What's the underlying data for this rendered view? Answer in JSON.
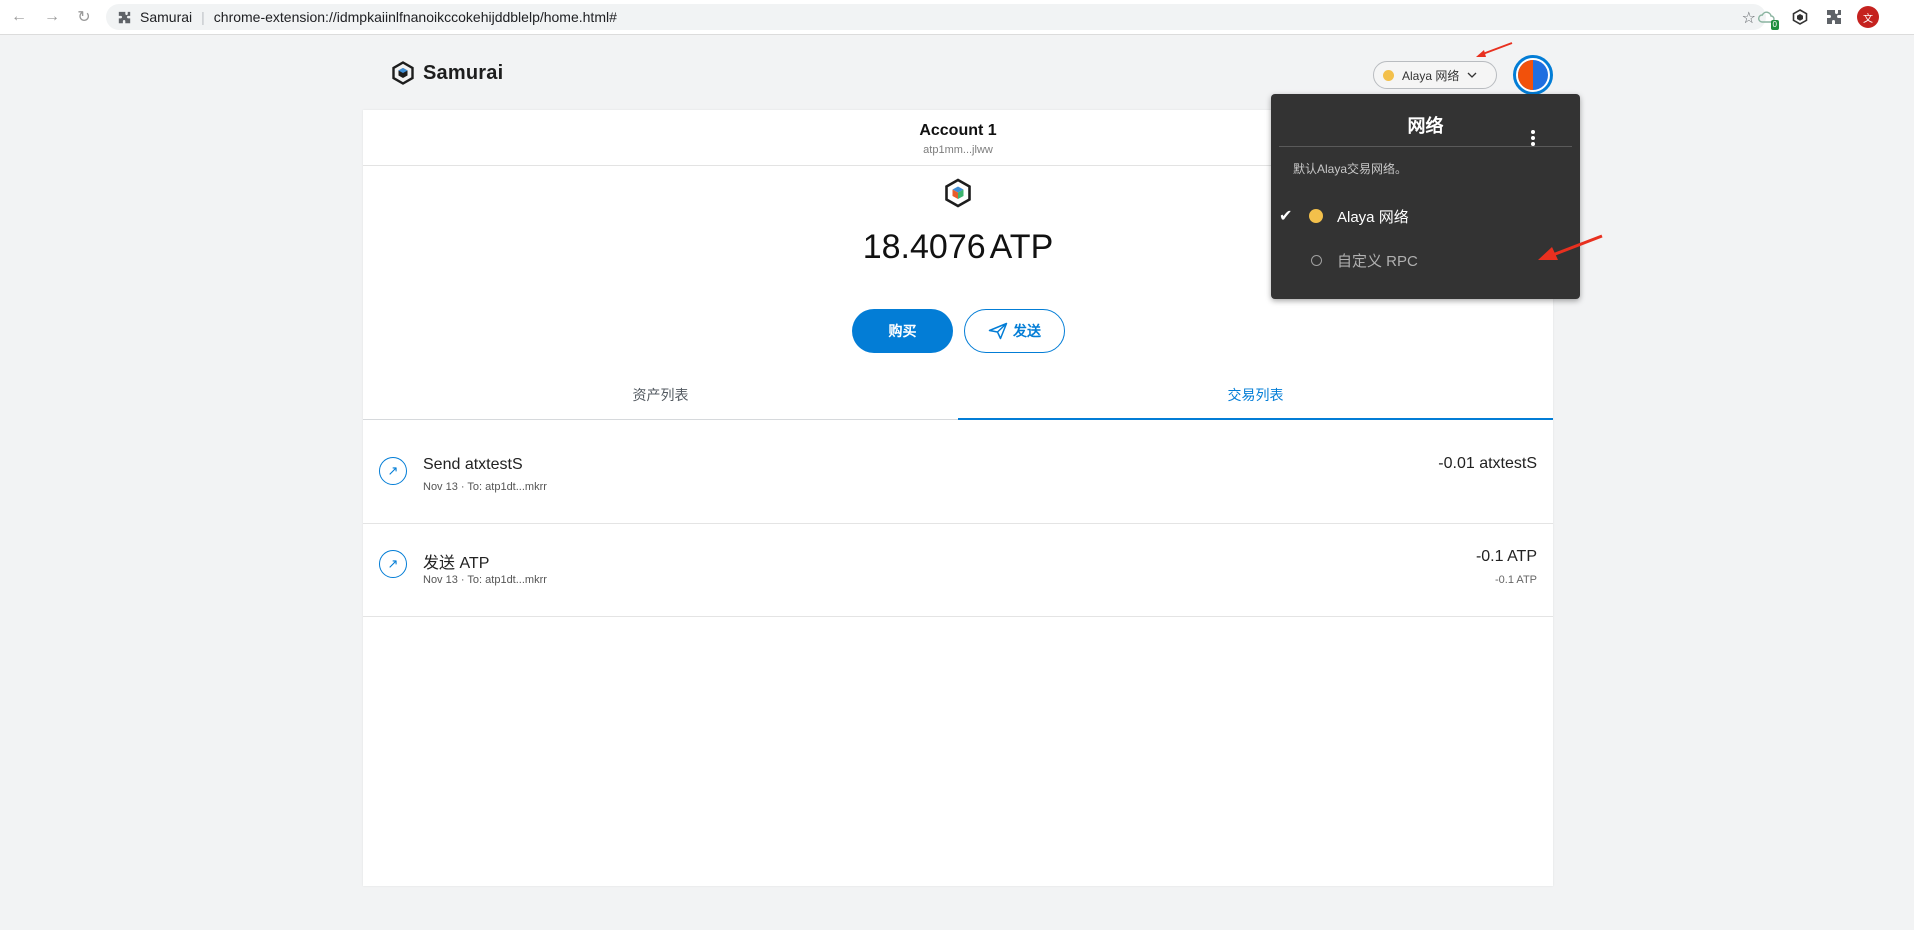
{
  "browser": {
    "site_name": "Samurai",
    "url": "chrome-extension://idmpkaiinlfnanoikccokehijddblelp/home.html#",
    "extension_badge": "0",
    "profile_initial": "文"
  },
  "header": {
    "app_name": "Samurai",
    "network_label": "Alaya 网络",
    "network_dot_color": "#f3c04b"
  },
  "account": {
    "name": "Account 1",
    "address": "atp1mm...jlww"
  },
  "balance": {
    "amount": "18.4076",
    "unit": "ATP"
  },
  "actions": {
    "buy_label": "购买",
    "send_label": "发送"
  },
  "tabs": [
    {
      "label": "资产列表",
      "active": false
    },
    {
      "label": "交易列表",
      "active": true
    }
  ],
  "transactions": [
    {
      "title": "Send atxtestS",
      "subtitle": "Nov 13 · To: atp1dt...mkrr",
      "amount": "-0.01 atxtestS",
      "secondary_amount": ""
    },
    {
      "title": "发送 ATP",
      "subtitle": "Nov 13 · To: atp1dt...mkrr",
      "amount": "-0.1 ATP",
      "secondary_amount": "-0.1 ATP"
    }
  ],
  "network_menu": {
    "title": "网络",
    "description": "默认Alaya交易网络。",
    "options": [
      {
        "label": "Alaya 网络",
        "selected": true,
        "dot_color": "#f3c04b"
      },
      {
        "label": "自定义 RPC",
        "selected": false,
        "dot_color": ""
      }
    ]
  },
  "colors": {
    "accent": "#037dd6",
    "annotation_arrow": "#e8301f",
    "menu_bg": "#333333"
  }
}
